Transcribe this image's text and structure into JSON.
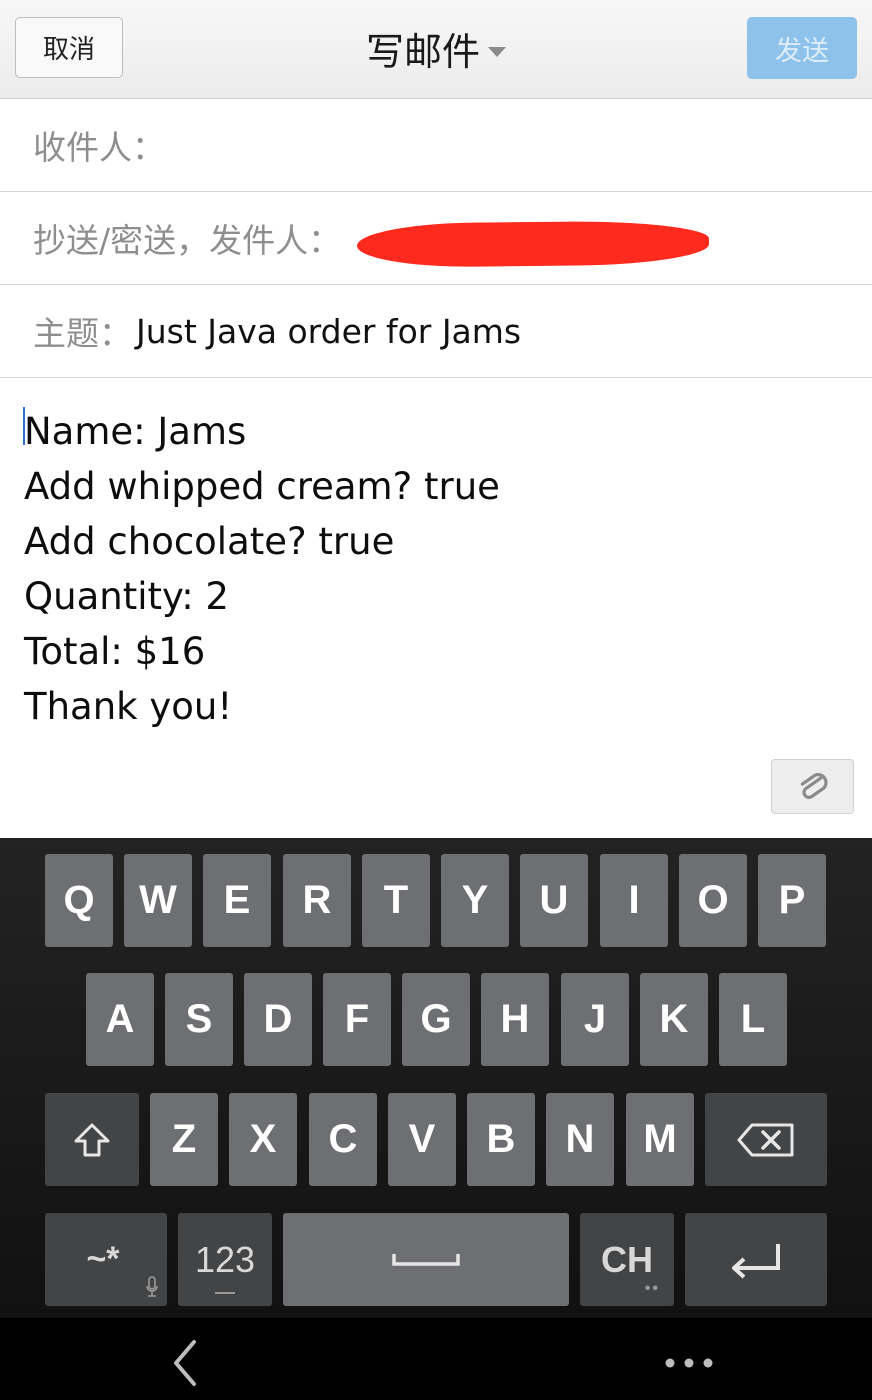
{
  "header": {
    "cancel_label": "取消",
    "title": "写邮件",
    "send_label": "发送"
  },
  "fields": {
    "to_label": "收件人：",
    "cc_label": "抄送/密送，发件人：",
    "subject_label": "主题：",
    "subject_value": "Just Java order for Jams"
  },
  "body_lines": [
    "Name: Jams",
    "Add whipped cream? true",
    "Add chocolate? true",
    "Quantity: 2",
    "Total: $16",
    "Thank you!"
  ],
  "keyboard": {
    "row1": [
      "Q",
      "W",
      "E",
      "R",
      "T",
      "Y",
      "U",
      "I",
      "O",
      "P"
    ],
    "row2": [
      "A",
      "S",
      "D",
      "F",
      "G",
      "H",
      "J",
      "K",
      "L"
    ],
    "row3": [
      "Z",
      "X",
      "C",
      "V",
      "B",
      "N",
      "M"
    ],
    "symbols_label": "~*",
    "numbers_label": "123",
    "lang_label": "CH"
  },
  "colors": {
    "send_button": "#8ec2ea",
    "redaction": "#ff2a1e",
    "key": "#6e6f72",
    "key_dark": "#434446"
  },
  "icons": [
    "chevron-down-icon",
    "paperclip-icon",
    "shift-icon",
    "backspace-icon",
    "mic-icon",
    "space-icon",
    "enter-icon",
    "back-icon",
    "more-icon"
  ]
}
